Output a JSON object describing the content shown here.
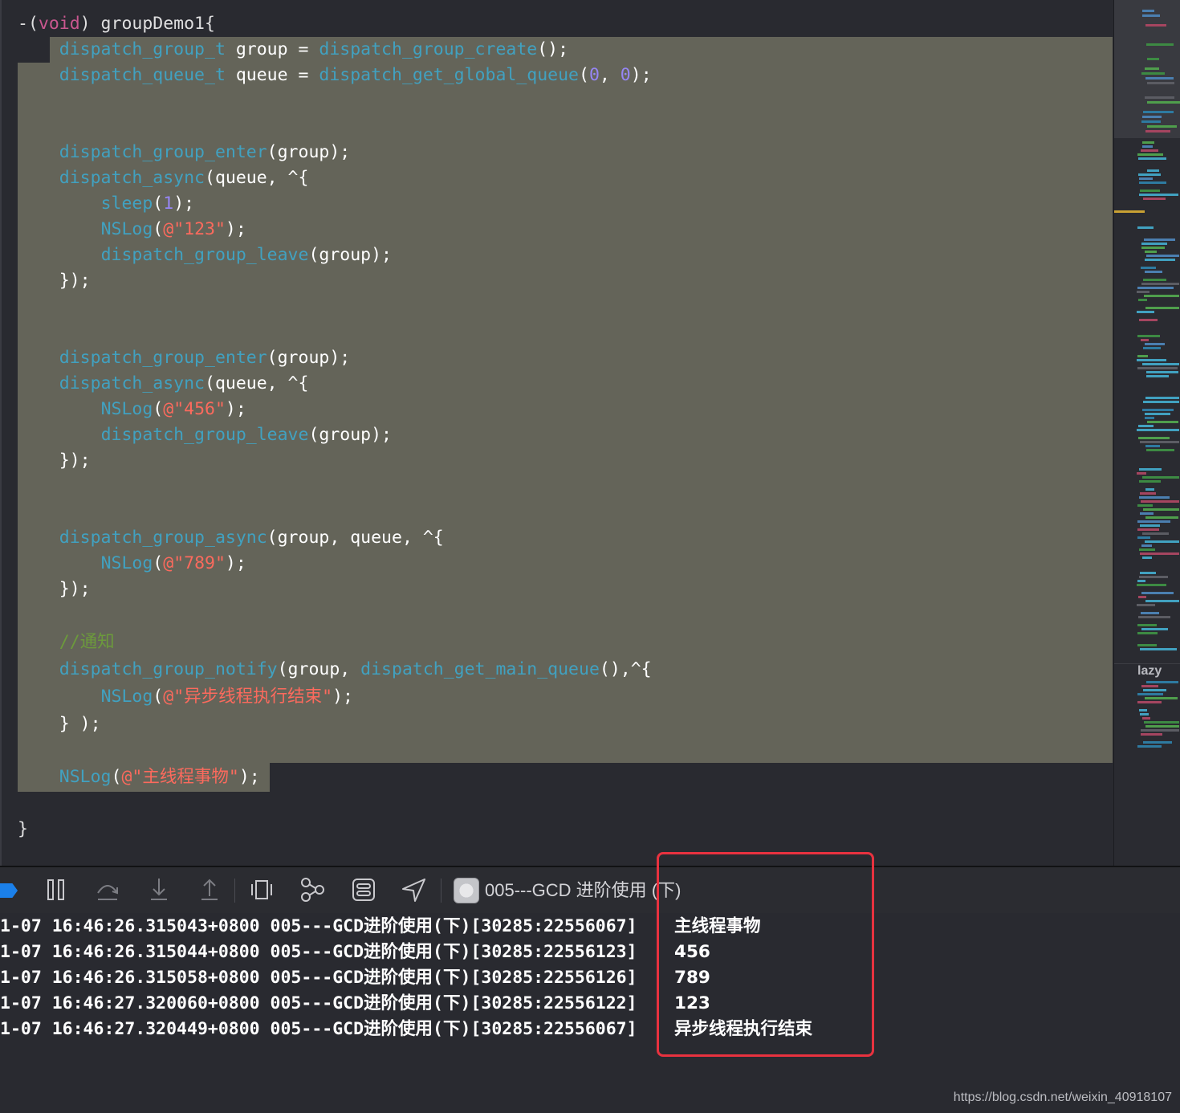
{
  "editor": {
    "signature": {
      "open": "-(",
      "void": "void",
      "close": ") groupDemo1{"
    },
    "line_group_create": {
      "type": "dispatch_group_t",
      "var": " group = ",
      "fn": "dispatch_group_create",
      "rest": "();"
    },
    "line_queue": {
      "type": "dispatch_queue_t",
      "var": " queue = ",
      "fn": "dispatch_get_global_queue",
      "p1": "(",
      "a1": "0",
      "sep": ", ",
      "a2": "0",
      "end": ");"
    },
    "enter1": {
      "fn": "dispatch_group_enter",
      "rest": "(group);"
    },
    "async1": {
      "fn": "dispatch_async",
      "rest": "(queue, ^{"
    },
    "sleep": {
      "fn": "sleep",
      "p": "(",
      "num": "1",
      "end": ");"
    },
    "nslog123": {
      "fn": "NSLog",
      "p": "(",
      "str": "@\"123\"",
      "end": ");"
    },
    "leave1": {
      "fn": "dispatch_group_leave",
      "rest": "(group);"
    },
    "close1": "});",
    "enter2": {
      "fn": "dispatch_group_enter",
      "rest": "(group);"
    },
    "async2": {
      "fn": "dispatch_async",
      "rest": "(queue, ^{"
    },
    "nslog456": {
      "fn": "NSLog",
      "p": "(",
      "str": "@\"456\"",
      "end": ");"
    },
    "leave2": {
      "fn": "dispatch_group_leave",
      "rest": "(group);"
    },
    "close2": "});",
    "group_async": {
      "fn": "dispatch_group_async",
      "rest": "(group, queue, ^{"
    },
    "nslog789": {
      "fn": "NSLog",
      "p": "(",
      "str": "@\"789\"",
      "end": ");"
    },
    "close3": "});",
    "comment": "//通知",
    "notify": {
      "fn": "dispatch_group_notify",
      "mid": "(group, ",
      "fn2": "dispatch_get_main_queue",
      "rest": "(),^{"
    },
    "nslog_done": {
      "fn": "NSLog",
      "p": "(",
      "str": "@\"异步线程执行结束\"",
      "end": ");"
    },
    "close4": "} );",
    "nslog_main": {
      "fn": "NSLog",
      "p": "(",
      "str": "@\"主线程事物\"",
      "end": ");"
    },
    "final_brace": "}"
  },
  "minimap": {
    "label": "lazy"
  },
  "debug_bar": {
    "icons": [
      "breakpoints-toggle",
      "pause-icon",
      "step-over-icon",
      "step-into-icon",
      "step-out-icon",
      "view-hierarchy-icon",
      "memory-graph-icon",
      "environment-overrides-icon",
      "location-icon",
      "app-target-icon"
    ],
    "target_name": "005---GCD 进阶使用 (下)"
  },
  "console": {
    "lines": [
      {
        "prefix": "1-07 16:46:26.315043+0800 005---GCD进阶使用(下)[30285:22556067]",
        "message": "主线程事物"
      },
      {
        "prefix": "1-07 16:46:26.315044+0800 005---GCD进阶使用(下)[30285:22556123]",
        "message": "456"
      },
      {
        "prefix": "1-07 16:46:26.315058+0800 005---GCD进阶使用(下)[30285:22556126]",
        "message": "789"
      },
      {
        "prefix": "1-07 16:46:27.320060+0800 005---GCD进阶使用(下)[30285:22556122]",
        "message": "123"
      },
      {
        "prefix": "1-07 16:46:27.320449+0800 005---GCD进阶使用(下)[30285:22556067]",
        "message": "异步线程执行结束"
      }
    ]
  },
  "watermark": "https://blog.csdn.net/weixin_40918107",
  "colors": {
    "selection": "#646459",
    "function": "#41a1c0",
    "string": "#fc6a5d",
    "number": "#9686f5",
    "comment": "#6c9a3c",
    "highlight_box": "#e8323f"
  }
}
